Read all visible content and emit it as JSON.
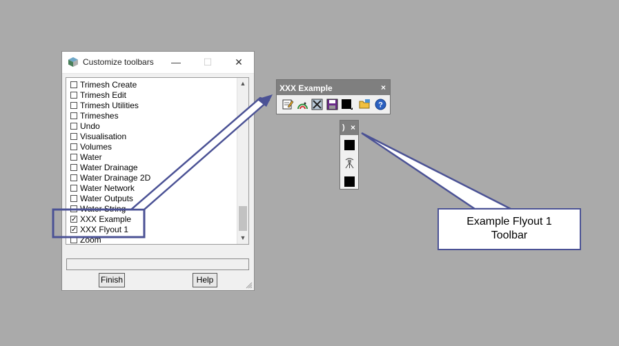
{
  "dialog": {
    "title": "Customize toolbars",
    "min_glyph": "—",
    "max_glyph": "☐",
    "close_glyph": "✕",
    "items": [
      {
        "label": "Trimesh Create",
        "checked": false
      },
      {
        "label": "Trimesh Edit",
        "checked": false
      },
      {
        "label": "Trimesh Utilities",
        "checked": false
      },
      {
        "label": "Trimeshes",
        "checked": false
      },
      {
        "label": "Undo",
        "checked": false
      },
      {
        "label": "Visualisation",
        "checked": false
      },
      {
        "label": "Volumes",
        "checked": false
      },
      {
        "label": "Water",
        "checked": false
      },
      {
        "label": "Water Drainage",
        "checked": false
      },
      {
        "label": "Water Drainage 2D",
        "checked": false
      },
      {
        "label": "Water Network",
        "checked": false
      },
      {
        "label": "Water Outputs",
        "checked": false
      },
      {
        "label": "Water String",
        "checked": false
      },
      {
        "label": "XXX Example",
        "checked": true
      },
      {
        "label": "XXX Flyout 1",
        "checked": true
      },
      {
        "label": "Zoom",
        "checked": false
      }
    ],
    "finish_label": "Finish",
    "help_label": "Help"
  },
  "toolbar": {
    "title": "XXX Example",
    "close_glyph": "×",
    "icons": [
      "edit-icon",
      "rainbow-icon",
      "tools-icon",
      "save-icon",
      "black-square-flyout-icon",
      "folder-icon",
      "help-icon"
    ]
  },
  "flyout": {
    "title": ")",
    "close_glyph": "×",
    "icons": [
      "black-square-icon",
      "survey-instrument-icon",
      "black-square-icon"
    ]
  },
  "annotation": {
    "line1": "Example Flyout 1",
    "line2": "Toolbar",
    "color": "#4b5295"
  }
}
